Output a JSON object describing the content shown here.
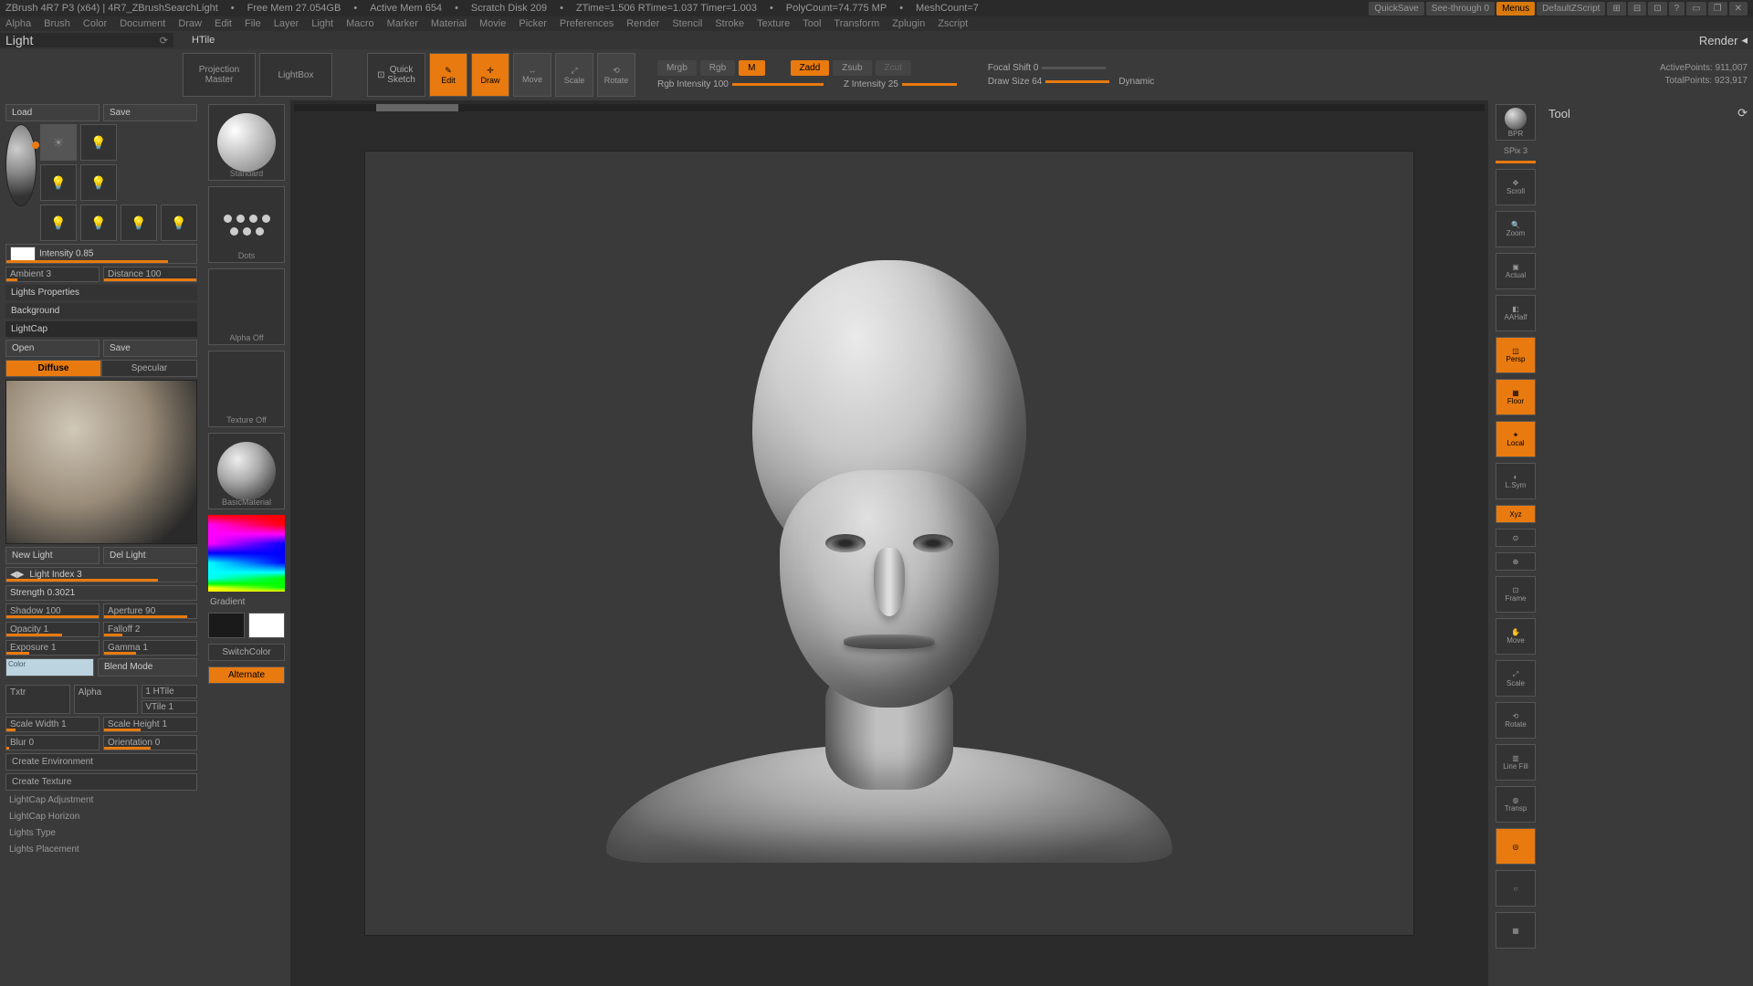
{
  "infobar": {
    "version": "ZBrush 4R7 P3 (x64)  |  4R7_ZBrushSearchLight",
    "freemem": "Free Mem  27.054GB",
    "activemem": "Active Mem  654",
    "scratch": "Scratch Disk  209",
    "ztime": "ZTime=1.506  RTime=1.037  Timer=1.003",
    "polycount": "PolyCount=74.775 MP",
    "meshcount": "MeshCount=7",
    "quicksave": "QuickSave",
    "seethru": "See-through  0",
    "menus": "Menus",
    "script": "DefaultZScript"
  },
  "menubar": [
    "Alpha",
    "Brush",
    "Color",
    "Document",
    "Draw",
    "Edit",
    "File",
    "Layer",
    "Light",
    "Macro",
    "Marker",
    "Material",
    "Movie",
    "Picker",
    "Preferences",
    "Render",
    "Stencil",
    "Stroke",
    "Texture",
    "Tool",
    "Transform",
    "Zplugin",
    "Zscript"
  ],
  "titlestrip": {
    "left": "Light",
    "tool": "HTile",
    "render": "Render",
    "rightlabel": "Tool"
  },
  "toolbar": {
    "projection": "Projection\nMaster",
    "lightbox": "LightBox",
    "quick": "Quick\nSketch",
    "modes": [
      "Edit",
      "Draw",
      "Move",
      "Scale",
      "Rotate"
    ],
    "chips_row1": [
      "Mrgb",
      "Rgb",
      "M",
      "Zadd",
      "Zsub",
      "Zcut"
    ],
    "rgbint": "Rgb Intensity 100",
    "zint": "Z Intensity 25",
    "focal": "Focal Shift 0",
    "drawsize": "Draw Size 64",
    "dynamic": "Dynamic",
    "active": "ActivePoints:  911,007",
    "total": "TotalPoints:  923,917"
  },
  "left": {
    "load": "Load",
    "save": "Save",
    "intensity": "Intensity 0.85",
    "ambient": "Ambient 3",
    "distance": "Distance 100",
    "props": "Lights Properties",
    "background": "Background",
    "lightcap": "LightCap",
    "open": "Open",
    "diffuse": "Diffuse",
    "specular": "Specular",
    "newlight": "New Light",
    "dellight": "Del Light",
    "lightindex": "Light Index 3",
    "strength": "Strength 0.3021",
    "shadow": "Shadow 100",
    "aperture": "Aperture 90",
    "opacity": "Opacity 1",
    "falloff": "Falloff 2",
    "exposure": "Exposure 1",
    "gamma": "Gamma 1",
    "colorlbl": "Color",
    "blend": "Blend Mode",
    "txtr": "Txtr",
    "alpha": "Alpha",
    "htile": "1  HTile",
    "vtile": "VTile 1",
    "scalew": "Scale Width 1",
    "scaleh": "Scale Height 1",
    "blur": "Blur 0",
    "orient": "Orientation 0",
    "createenv": "Create Environment",
    "createtex": "Create Texture",
    "adj": "LightCap Adjustment",
    "horizon": "LightCap Horizon",
    "ltype": "Lights Type",
    "lplace": "Lights Placement"
  },
  "tray": {
    "standard": "Standard",
    "dots": "Dots",
    "alphaoff": "Alpha Off",
    "texoff": "Texture Off",
    "mat": "BasicMaterial",
    "gradient": "Gradient",
    "switch": "SwitchColor",
    "alt": "Alternate"
  },
  "shelf": {
    "bpr": "BPR",
    "spix": "SPix 3",
    "scroll": "Scroll",
    "zoom": "Zoom",
    "actual": "Actual",
    "aahalf": "AAHalf",
    "persp": "Persp",
    "floor": "Floor",
    "local": "Local",
    "lsym": "L.Sym",
    "xyz": "Xyz",
    "frame": "Frame",
    "move": "Move",
    "scale": "Scale",
    "rotate": "Rotate",
    "linefill": "Line Fill",
    "transp": "Transp"
  }
}
